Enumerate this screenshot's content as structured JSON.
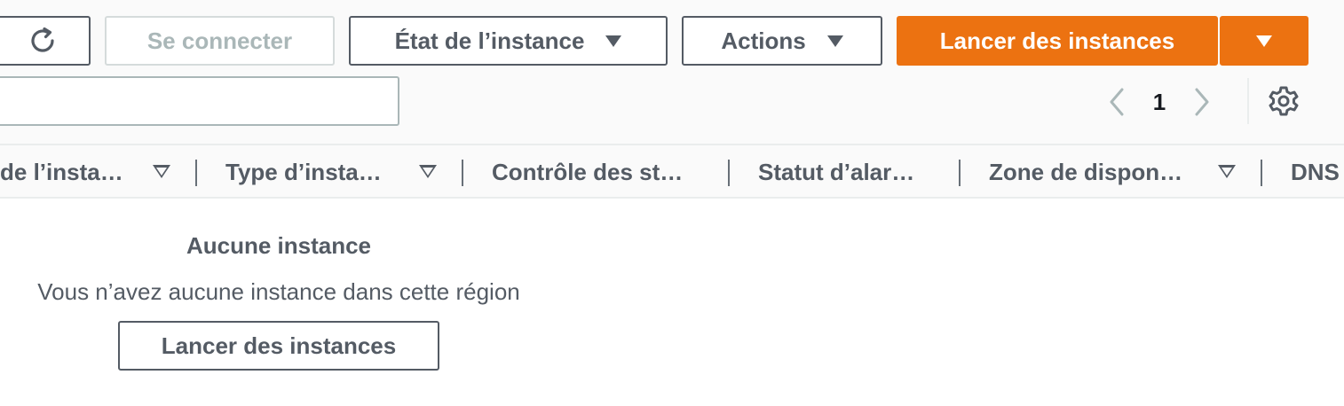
{
  "toolbar": {
    "connect_label": "Se connecter",
    "instance_state_label": "État de l’instance",
    "actions_label": "Actions",
    "launch_label": "Lancer des instances"
  },
  "pagination": {
    "current_page": "1"
  },
  "table": {
    "columns": [
      {
        "label": "de l’insta…",
        "sortable": true
      },
      {
        "label": "Type d’insta…",
        "sortable": true
      },
      {
        "label": "Contrôle des st…",
        "sortable": false
      },
      {
        "label": "Statut d’alar…",
        "sortable": false
      },
      {
        "label": "Zone de dispon…",
        "sortable": true
      },
      {
        "label": "DNS",
        "sortable": false
      }
    ]
  },
  "empty_state": {
    "title": "Aucune instance",
    "description": "Vous n’avez aucune instance dans cette région",
    "launch_label": "Lancer des instances"
  },
  "icons": {
    "refresh": "refresh-icon",
    "prev": "chevron-left-icon",
    "next": "chevron-right-icon",
    "settings": "gear-icon",
    "dropdown": "caret-down-icon"
  },
  "colors": {
    "primary": "#ec7211",
    "text": "#545b64",
    "disabled": "#aab7b8",
    "divider": "#eaeded"
  }
}
